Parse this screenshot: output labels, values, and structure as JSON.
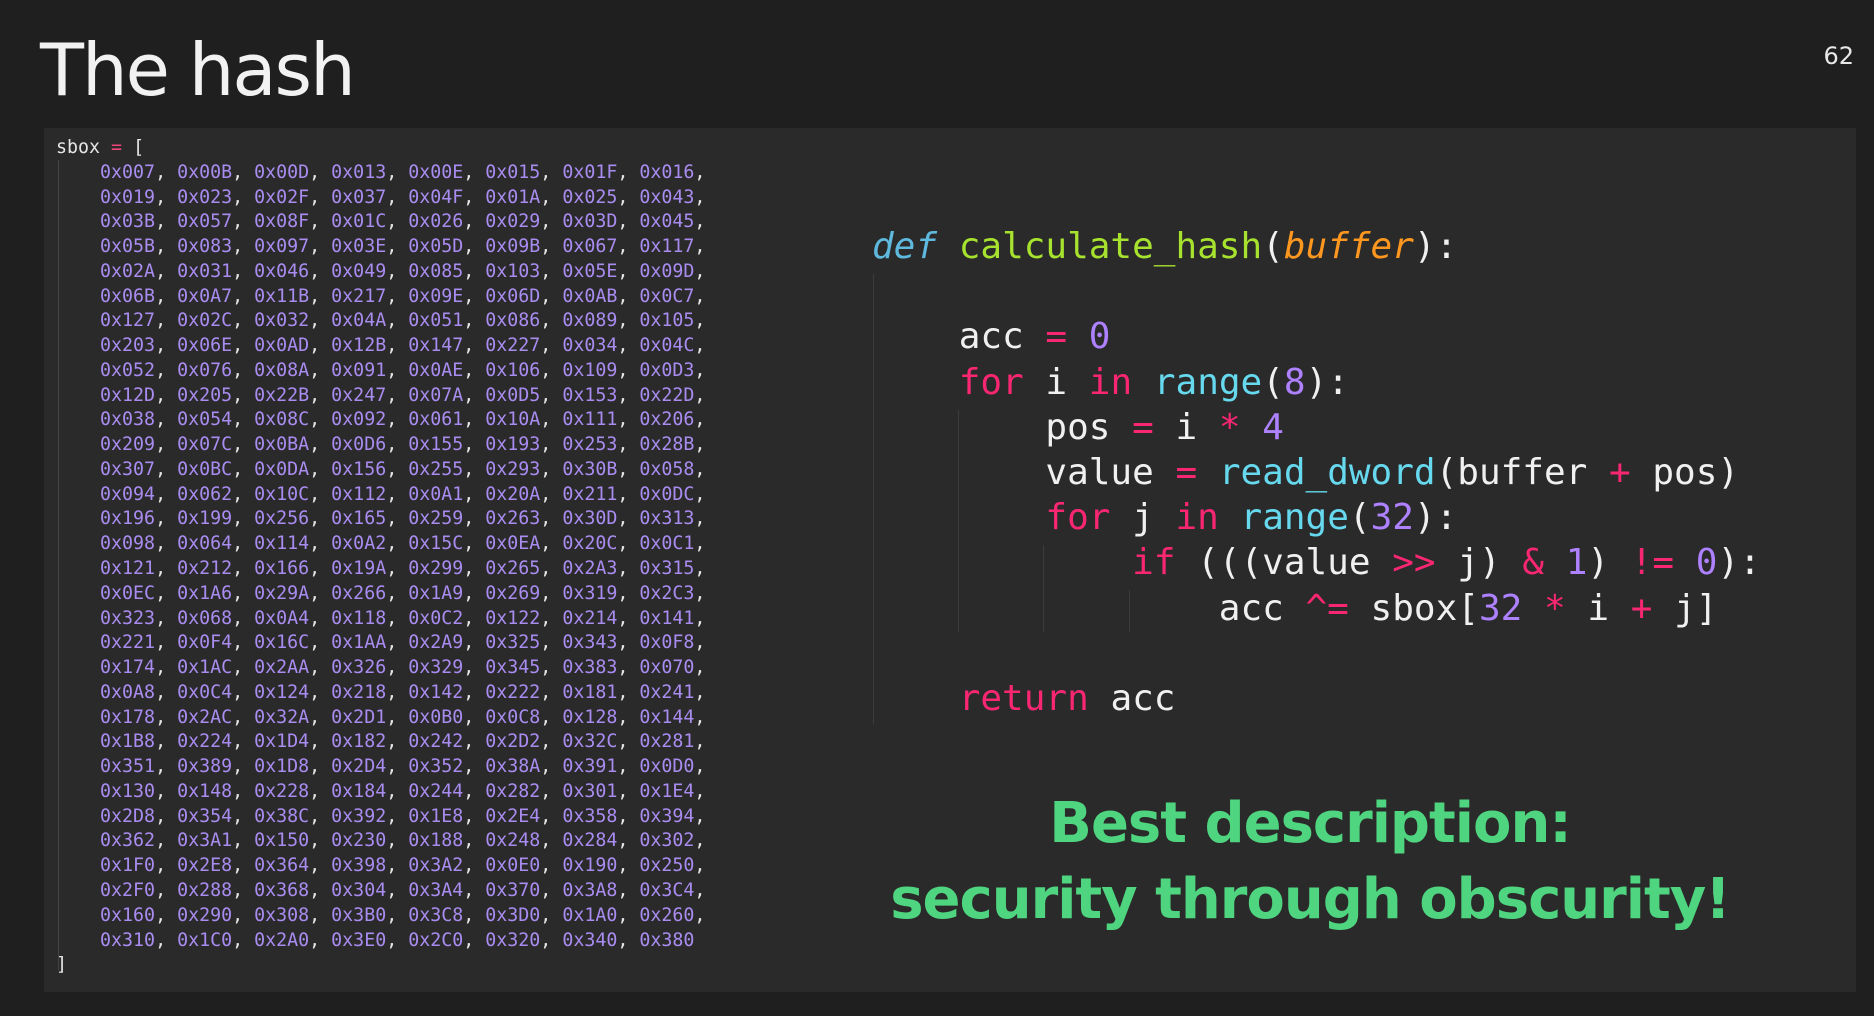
{
  "slide": {
    "title": "The hash",
    "page_number": "62"
  },
  "sbox": {
    "name": "sbox",
    "assign": "=",
    "open": "[",
    "close": "]",
    "rows": [
      [
        "0x007",
        "0x00B",
        "0x00D",
        "0x013",
        "0x00E",
        "0x015",
        "0x01F",
        "0x016"
      ],
      [
        "0x019",
        "0x023",
        "0x02F",
        "0x037",
        "0x04F",
        "0x01A",
        "0x025",
        "0x043"
      ],
      [
        "0x03B",
        "0x057",
        "0x08F",
        "0x01C",
        "0x026",
        "0x029",
        "0x03D",
        "0x045"
      ],
      [
        "0x05B",
        "0x083",
        "0x097",
        "0x03E",
        "0x05D",
        "0x09B",
        "0x067",
        "0x117"
      ],
      [
        "0x02A",
        "0x031",
        "0x046",
        "0x049",
        "0x085",
        "0x103",
        "0x05E",
        "0x09D"
      ],
      [
        "0x06B",
        "0x0A7",
        "0x11B",
        "0x217",
        "0x09E",
        "0x06D",
        "0x0AB",
        "0x0C7"
      ],
      [
        "0x127",
        "0x02C",
        "0x032",
        "0x04A",
        "0x051",
        "0x086",
        "0x089",
        "0x105"
      ],
      [
        "0x203",
        "0x06E",
        "0x0AD",
        "0x12B",
        "0x147",
        "0x227",
        "0x034",
        "0x04C"
      ],
      [
        "0x052",
        "0x076",
        "0x08A",
        "0x091",
        "0x0AE",
        "0x106",
        "0x109",
        "0x0D3"
      ],
      [
        "0x12D",
        "0x205",
        "0x22B",
        "0x247",
        "0x07A",
        "0x0D5",
        "0x153",
        "0x22D"
      ],
      [
        "0x038",
        "0x054",
        "0x08C",
        "0x092",
        "0x061",
        "0x10A",
        "0x111",
        "0x206"
      ],
      [
        "0x209",
        "0x07C",
        "0x0BA",
        "0x0D6",
        "0x155",
        "0x193",
        "0x253",
        "0x28B"
      ],
      [
        "0x307",
        "0x0BC",
        "0x0DA",
        "0x156",
        "0x255",
        "0x293",
        "0x30B",
        "0x058"
      ],
      [
        "0x094",
        "0x062",
        "0x10C",
        "0x112",
        "0x0A1",
        "0x20A",
        "0x211",
        "0x0DC"
      ],
      [
        "0x196",
        "0x199",
        "0x256",
        "0x165",
        "0x259",
        "0x263",
        "0x30D",
        "0x313"
      ],
      [
        "0x098",
        "0x064",
        "0x114",
        "0x0A2",
        "0x15C",
        "0x0EA",
        "0x20C",
        "0x0C1"
      ],
      [
        "0x121",
        "0x212",
        "0x166",
        "0x19A",
        "0x299",
        "0x265",
        "0x2A3",
        "0x315"
      ],
      [
        "0x0EC",
        "0x1A6",
        "0x29A",
        "0x266",
        "0x1A9",
        "0x269",
        "0x319",
        "0x2C3"
      ],
      [
        "0x323",
        "0x068",
        "0x0A4",
        "0x118",
        "0x0C2",
        "0x122",
        "0x214",
        "0x141"
      ],
      [
        "0x221",
        "0x0F4",
        "0x16C",
        "0x1AA",
        "0x2A9",
        "0x325",
        "0x343",
        "0x0F8"
      ],
      [
        "0x174",
        "0x1AC",
        "0x2AA",
        "0x326",
        "0x329",
        "0x345",
        "0x383",
        "0x070"
      ],
      [
        "0x0A8",
        "0x0C4",
        "0x124",
        "0x218",
        "0x142",
        "0x222",
        "0x181",
        "0x241"
      ],
      [
        "0x178",
        "0x2AC",
        "0x32A",
        "0x2D1",
        "0x0B0",
        "0x0C8",
        "0x128",
        "0x144"
      ],
      [
        "0x1B8",
        "0x224",
        "0x1D4",
        "0x182",
        "0x242",
        "0x2D2",
        "0x32C",
        "0x281"
      ],
      [
        "0x351",
        "0x389",
        "0x1D8",
        "0x2D4",
        "0x352",
        "0x38A",
        "0x391",
        "0x0D0"
      ],
      [
        "0x130",
        "0x148",
        "0x228",
        "0x184",
        "0x244",
        "0x282",
        "0x301",
        "0x1E4"
      ],
      [
        "0x2D8",
        "0x354",
        "0x38C",
        "0x392",
        "0x1E8",
        "0x2E4",
        "0x358",
        "0x394"
      ],
      [
        "0x362",
        "0x3A1",
        "0x150",
        "0x230",
        "0x188",
        "0x248",
        "0x284",
        "0x302"
      ],
      [
        "0x1F0",
        "0x2E8",
        "0x364",
        "0x398",
        "0x3A2",
        "0x0E0",
        "0x190",
        "0x250"
      ],
      [
        "0x2F0",
        "0x288",
        "0x368",
        "0x304",
        "0x3A4",
        "0x370",
        "0x3A8",
        "0x3C4"
      ],
      [
        "0x160",
        "0x290",
        "0x308",
        "0x3B0",
        "0x3C8",
        "0x3D0",
        "0x1A0",
        "0x260"
      ],
      [
        "0x310",
        "0x1C0",
        "0x2A0",
        "0x3E0",
        "0x2C0",
        "0x320",
        "0x340",
        "0x380"
      ]
    ]
  },
  "code": {
    "def_kw": "def",
    "func_name": "calculate_hash",
    "param": "buffer",
    "acc": "acc",
    "zero": "0",
    "for_kw": "for",
    "in_kw": "in",
    "range_fn": "range",
    "eight": "8",
    "i": "i",
    "j": "j",
    "pos": "pos",
    "four": "4",
    "value": "value",
    "read_fn": "read_dword",
    "buffer": "buffer",
    "thirty_two": "32",
    "if_kw": "if",
    "one": "1",
    "sbox": "sbox",
    "return_kw": "return",
    "op_assign": "=",
    "op_mul": "*",
    "op_add": "+",
    "op_shr": ">>",
    "op_and": "&",
    "op_ne": "!=",
    "op_xor_assign": "^="
  },
  "tagline": {
    "line1": "Best description:",
    "line2": "security through obscurity!"
  },
  "colors": {
    "background": "#1f1f1f",
    "panel": "#2a2a2a",
    "hex_values": "#a98cf0",
    "keyword": "#f92672",
    "function": "#a6e22e",
    "number": "#ae81ff",
    "builtin": "#66d9ef",
    "param": "#fd971f",
    "tagline": "#4fd47f"
  }
}
